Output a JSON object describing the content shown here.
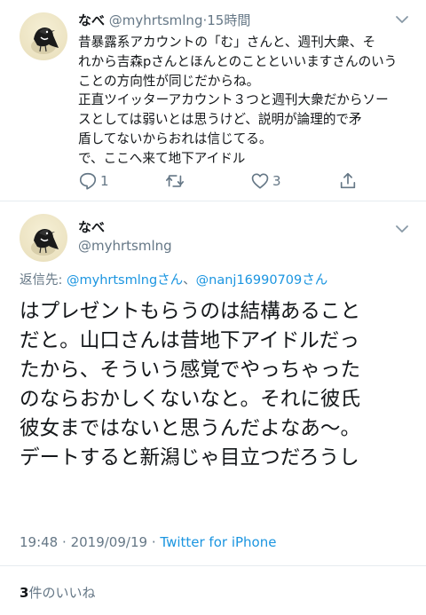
{
  "tweet1": {
    "name": "なべ",
    "handle": "@myhrtsmlng",
    "separator": "·",
    "time": "15時間",
    "lines": [
      "昔暴露系アカウントの「む」さんと、週刊大衆、そ",
      "れから吉森pさんとほんとのことといいますさんのいう",
      "ことの方向性が同じだからね。",
      "正直ツイッターアカウント３つと週刊大衆だからソー",
      "スとしては弱いとは思うけど、説明が論理的で矛",
      "盾してないからおれは信じてる。",
      "で、ここへ来て地下アイドル"
    ],
    "actions": {
      "reply_count": "1",
      "retweet_count": "",
      "like_count": "3"
    },
    "icons": [
      "reply-icon",
      "retweet-icon",
      "like-icon",
      "share-icon",
      "chevron-down-icon"
    ]
  },
  "tweet2": {
    "name": "なべ",
    "handle": "@myhrtsmlng",
    "reply_prefix": "返信先: ",
    "reply_target_1": "@myhrtsmlngさん",
    "reply_joiner": "、",
    "reply_target_2": "@nanj16990709さん",
    "lines": [
      "はプレゼントもらうのは結構あること",
      "だと。山口さんは昔地下アイドルだっ",
      "たから、そういう感覚でやっちゃった",
      "のならおかしくないなと。それに彼氏",
      "彼女まではないと思うんだよなあ〜。",
      "デートすると新潟じゃ目立つだろうし"
    ],
    "time": "19:48",
    "date": "2019/09/19",
    "source": "Twitter for iPhone",
    "likes_number": "3",
    "likes_label": "件のいいね"
  },
  "colors": {
    "accent": "#1b95e0",
    "secondary_text": "#657786",
    "primary_text": "#14171a",
    "divider": "#e6ecf0"
  }
}
